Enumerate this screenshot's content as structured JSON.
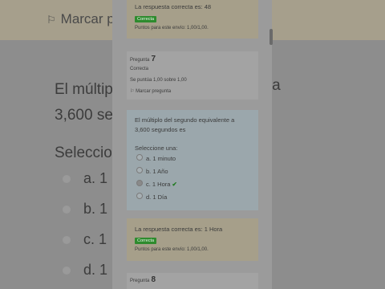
{
  "background": {
    "mark_label": "Marcar pre",
    "question_line1": "El múltiplo",
    "question_line1_end": "te a",
    "question_line2": "3,600 se",
    "select_label": "Seleccio",
    "options": [
      "a. 1",
      "b. 1",
      "c. 1",
      "d. 1"
    ]
  },
  "prev_feedback": {
    "answer_text": "La respuesta correcta es: 48",
    "badge": "Correcta",
    "points": "Puntos para este envío: 1,00/1,00."
  },
  "q7_info": {
    "label": "Pregunta",
    "number": "7",
    "status": "Correcta",
    "score": "Se puntúa 1,00 sobre 1,00",
    "flag": "Marcar pregunta"
  },
  "q7_body": {
    "text_line1": "El múltiplo del segundo equivalente a",
    "text_line2": "3,600 segundos es",
    "select_label": "Seleccione una:",
    "options": [
      {
        "label": "a. 1 minuto",
        "checked": false
      },
      {
        "label": "b. 1 Año",
        "checked": false
      },
      {
        "label": "c. 1 Hora",
        "checked": true
      },
      {
        "label": "d. 1 Día",
        "checked": false
      }
    ],
    "check_mark": "✔"
  },
  "q7_feedback": {
    "answer_text": "La respuesta correcta es: 1 Hora",
    "badge": "Correcta",
    "points": "Puntos para este envío: 1,00/1,00."
  },
  "q8_info": {
    "label": "Pregunta",
    "number": "8"
  },
  "icons": {
    "flag": "flag-icon",
    "check": "checkmark-icon"
  },
  "colors": {
    "correct_badge": "#2e8b2e",
    "feedback_bg": "#a69f8a",
    "question_bg": "#9ba7ac"
  }
}
